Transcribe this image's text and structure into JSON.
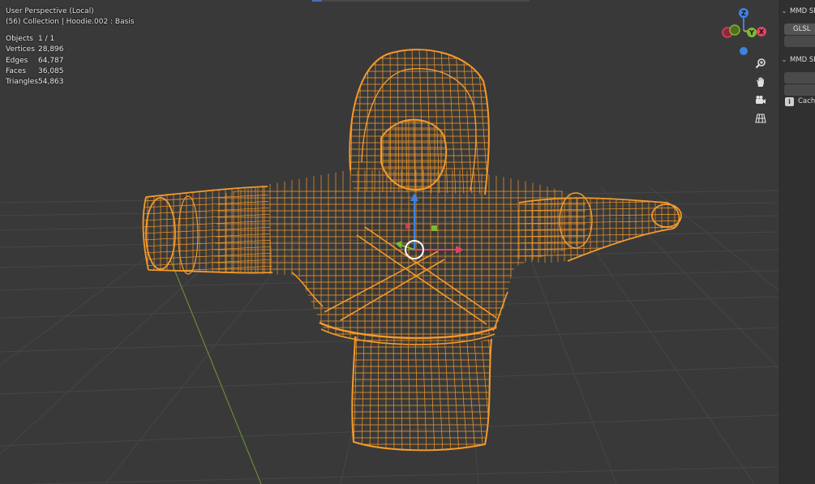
{
  "viewport": {
    "title": "User Perspective (Local)",
    "subtitle": "(56) Collection | Hoodie.002 : Basis",
    "stats": [
      {
        "label": "Objects",
        "value": "1 / 1"
      },
      {
        "label": "Vertices",
        "value": "28,896"
      },
      {
        "label": "Edges",
        "value": "64,787"
      },
      {
        "label": "Faces",
        "value": "36,085"
      },
      {
        "label": "Triangles",
        "value": "54,863"
      }
    ],
    "gizmo": {
      "x_label": "X",
      "y_label": "Y",
      "z_label": "Z"
    },
    "nav_icons": [
      "zoom-icon",
      "pan-hand-icon",
      "camera-icon",
      "perspective-grid-icon"
    ]
  },
  "sidebar": {
    "panel1": {
      "title": "MMD Sh",
      "button": "GLSL"
    },
    "panel2": {
      "title": "MMD SD",
      "cache_label": "Cache",
      "cache_icon": "i"
    }
  },
  "colors": {
    "background": "#393939",
    "grid": "#4a4a4a",
    "wire": "#f59a2a",
    "x_axis": "#e04560",
    "y_axis": "#7fb832",
    "z_axis": "#3d84e0",
    "panel": "#303030"
  }
}
